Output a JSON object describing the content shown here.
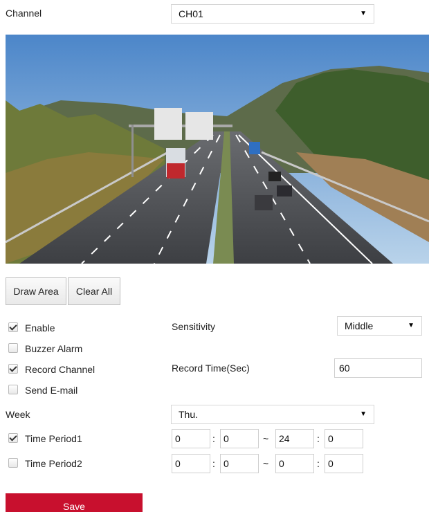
{
  "channel": {
    "label": "Channel",
    "selected": "CH01"
  },
  "preview": {
    "description": "camera-preview-highway"
  },
  "buttons": {
    "draw_area": "Draw Area",
    "clear_all": "Clear All",
    "save": "Save"
  },
  "options": {
    "enable": {
      "label": "Enable",
      "checked": true
    },
    "buzzer_alarm": {
      "label": "Buzzer Alarm",
      "checked": false
    },
    "record_channel": {
      "label": "Record Channel",
      "checked": true
    },
    "send_email": {
      "label": "Send E-mail",
      "checked": false
    }
  },
  "sensitivity": {
    "label": "Sensitivity",
    "selected": "Middle"
  },
  "record_time": {
    "label": "Record Time(Sec)",
    "value": "60"
  },
  "week": {
    "label": "Week",
    "selected": "Thu."
  },
  "time_periods": [
    {
      "label": "Time Period1",
      "checked": true,
      "start_h": "0",
      "start_m": "0",
      "end_h": "24",
      "end_m": "0"
    },
    {
      "label": "Time Period2",
      "checked": false,
      "start_h": "0",
      "start_m": "0",
      "end_h": "0",
      "end_m": "0"
    }
  ],
  "separators": {
    "colon": ":",
    "tilde": "~"
  },
  "icons": {
    "caret": "caret-down-icon",
    "check": "checkmark-icon"
  },
  "colors": {
    "save_bg": "#c8102e"
  }
}
